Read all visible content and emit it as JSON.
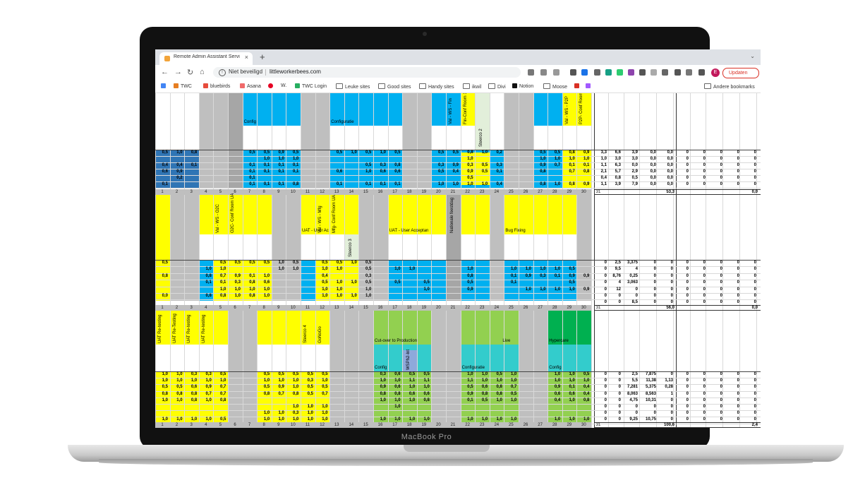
{
  "device": {
    "brand": "MacBook Pro"
  },
  "browser": {
    "tab_title": "Remote Admin Assistant Servi",
    "security_label": "Niet beveiligd",
    "url": "littleworkerbees.com",
    "update_label": "Updaten",
    "profile_initial": "E",
    "bookmarks": [
      "TWC",
      "bluebirds",
      "Asana",
      "W.",
      "TWC Login",
      "Leuke sites",
      "Good sites",
      "Handy sites",
      "ikwil",
      "Divi",
      "Notion",
      "Moose"
    ],
    "other_bookmarks": "Andere bookmarks"
  },
  "colors": {
    "blue": "#00b0f0",
    "yellow": "#ffff00",
    "gray": "#bfbfbf",
    "green": "#92d050",
    "cyan": "#33cccc",
    "darkblue": "#2f75b5",
    "darkgreen": "#00b050"
  },
  "sheet": {
    "bands": [
      {
        "labels": [
          "Config",
          "Configuratie"
        ],
        "vertical_labels": [
          "Val - WS - Fin",
          "Fin-Conf Room 1",
          "Steerco 2",
          "Val - WS - P2P",
          "P2P- Conf Room"
        ],
        "summary_rows": [
          [
            "3,3",
            "6,6",
            "3,9",
            "0,0",
            "0,0"
          ],
          [
            "1,0",
            "3,0",
            "3,0",
            "0,0",
            "0,0"
          ],
          [
            "1,1",
            "6,3",
            "0,0",
            "0,0",
            "0,0"
          ],
          [
            "2,1",
            "5,7",
            "2,9",
            "0,0",
            "0,0"
          ],
          [
            "0,4",
            "0,8",
            "0,5",
            "0,0",
            "0,0"
          ],
          [
            "1,1",
            "3,9",
            "7,9",
            "0,0",
            "0,0"
          ]
        ],
        "total": "53,3",
        "right_total": "0,0"
      },
      {
        "labels": [
          "UAT - User Ac",
          "UAT - User Acceptan",
          "Bug Fixing"
        ],
        "vertical_labels": [
          "Val - WS - O2C",
          "O2C- Conf Room UA",
          "Val - WS - Mfg",
          "Mfg- Conf Room UA",
          "Steerco 3",
          "Nationale feestdag"
        ],
        "summary_rows": [
          [
            "0",
            "2,5",
            "3,375",
            "0",
            "0"
          ],
          [
            "0",
            "9,5",
            "4",
            "0",
            "0"
          ],
          [
            "0",
            "8,76",
            "0,25",
            "0",
            "0"
          ],
          [
            "0",
            "4",
            "3,063",
            "0",
            "0"
          ],
          [
            "0",
            "12",
            "0",
            "0",
            "0"
          ],
          [
            "0",
            "0",
            "0",
            "0",
            "0"
          ],
          [
            "0",
            "0",
            "8,5",
            "0",
            "0"
          ]
        ],
        "total": "56,0",
        "right_total": "0,0"
      },
      {
        "labels": [
          "Cut-over to Production",
          "Live",
          "Hypercare",
          "Config",
          "Configuratie",
          "Config"
        ],
        "vertical_labels": [
          "UAT Re-testing",
          "UAT Re-Testing",
          "UAT Re-testing",
          "UAT Re-testing",
          "Steerco 4",
          "GoNoGo",
          "WSPh2-Int"
        ],
        "summary_rows": [
          [
            "0",
            "0",
            "2,5",
            "7,875",
            "0"
          ],
          [
            "0",
            "0",
            "5,5",
            "11,38",
            "1,13"
          ],
          [
            "0",
            "0",
            "7,281",
            "5,375",
            "0,28"
          ],
          [
            "0",
            "0",
            "8,063",
            "8,563",
            "1"
          ],
          [
            "0",
            "0",
            "4,75",
            "10,31",
            "0"
          ],
          [
            "0",
            "0",
            "0",
            "0",
            "0"
          ],
          [
            "0",
            "0",
            "0",
            "0",
            "0"
          ],
          [
            "0",
            "0",
            "9,25",
            "10,75",
            "0"
          ]
        ],
        "total": "100,6",
        "right_total": "2,4"
      }
    ],
    "band1_values": [
      [
        "0,5",
        "1,0",
        "0,8",
        "",
        "",
        "",
        "0,5",
        "0,5",
        "0,9",
        "0,5",
        "",
        "",
        "0,5",
        "1,0",
        "0,5",
        "1,0",
        "0,5",
        "",
        "",
        "0,5",
        "0,5",
        "0,8",
        "1,0",
        "0,2",
        "",
        "",
        "0,5",
        "0,5",
        "0,8",
        "0,9"
      ],
      [
        "",
        "",
        "",
        "",
        "",
        "",
        "",
        "1,0",
        "1,0",
        "1,0",
        "",
        "",
        "",
        "",
        "",
        "",
        "",
        "",
        "",
        "",
        "",
        "1,0",
        "",
        "",
        "",
        "",
        "1,0",
        "1,0",
        "1,0",
        "1,0"
      ],
      [
        "0,4",
        "0,4",
        "0,1",
        "",
        "",
        "",
        "0,1",
        "0,1",
        "0,1",
        "0,1",
        "",
        "",
        "",
        "",
        "0,5",
        "0,3",
        "0,8",
        "",
        "",
        "0,3",
        "0,9",
        "0,3",
        "0,5",
        "0,3",
        "",
        "",
        "0,9",
        "0,7",
        "0,1",
        "0,1"
      ],
      [
        "0,6",
        "0,9",
        "",
        "",
        "",
        "",
        "0,1",
        "0,1",
        "0,1",
        "0,1",
        "",
        "",
        "0,6",
        "",
        "1,0",
        "0,6",
        "0,6",
        "",
        "",
        "0,5",
        "0,4",
        "0,9",
        "0,5",
        "0,1",
        "",
        "",
        "0,8",
        "",
        "0,7",
        "0,8"
      ],
      [
        "",
        "0,2",
        "",
        "",
        "",
        "",
        "0,1",
        "",
        "",
        "",
        "",
        "",
        "",
        "",
        "",
        "",
        "",
        "",
        "",
        "",
        "",
        "0,5",
        "",
        "",
        "",
        "",
        "",
        "",
        "",
        ""
      ],
      [
        "0,1",
        "",
        "",
        "",
        "",
        "",
        "0,1",
        "0,1",
        "0,1",
        "0,8",
        "",
        "",
        "0,1",
        "",
        "0,1",
        "0,1",
        "0,1",
        "",
        "",
        "1,0",
        "1,0",
        "1,0",
        "1,0",
        "0,4",
        "",
        "",
        "0,8",
        "1,0",
        "0,8",
        "0,9"
      ]
    ],
    "band2_values": [
      [
        "0,5",
        "",
        "",
        "",
        "0,5",
        "0,5",
        "0,5",
        "0,5",
        "1,0",
        "0,5",
        "",
        "0,5",
        "0,5",
        "1,0",
        "0,5",
        "",
        "",
        "",
        "",
        "",
        "",
        "",
        "",
        "",
        "",
        "",
        "",
        "",
        "",
        ""
      ],
      [
        "",
        "",
        "",
        "1,0",
        "1,0",
        "",
        "",
        "",
        "1,0",
        "1,0",
        "",
        "1,0",
        "1,0",
        "",
        "0,5",
        "",
        "1,0",
        "1,0",
        "",
        "",
        "",
        "1,0",
        "",
        "",
        "1,0",
        "1,0",
        "1,0",
        "1,0",
        "0,5",
        ""
      ],
      [
        "0,8",
        "",
        "",
        "0,8",
        "0,7",
        "0,9",
        "0,1",
        "1,0",
        "",
        "",
        "",
        "0,4",
        "",
        "",
        "0,3",
        "",
        "",
        "",
        "",
        "",
        "",
        "0,8",
        "",
        "",
        "0,1",
        "0,9",
        "0,3",
        "0,1",
        "0,9",
        "0,9"
      ],
      [
        "",
        "",
        "",
        "0,1",
        "0,1",
        "0,3",
        "0,8",
        "0,6",
        "",
        "",
        "",
        "0,5",
        "1,0",
        "1,0",
        "0,5",
        "",
        "0,5",
        "",
        "0,5",
        "",
        "",
        "0,5",
        "",
        "",
        "0,1",
        "",
        "",
        "",
        "0,5",
        ""
      ],
      [
        "",
        "",
        "",
        "",
        "1,0",
        "1,0",
        "1,0",
        "1,0",
        "",
        "",
        "",
        "1,0",
        "1,0",
        "",
        "1,0",
        "",
        "",
        "",
        "1,0",
        "",
        "",
        "0,9",
        "",
        "",
        "",
        "1,0",
        "1,0",
        "1,0",
        "1,0",
        "0,9"
      ],
      [
        "0,0",
        "",
        "",
        "0,8",
        "0,8",
        "1,0",
        "0,8",
        "1,0",
        "",
        "",
        "",
        "1,0",
        "1,0",
        "1,0",
        "1,0",
        "",
        "",
        "",
        "",
        "",
        "",
        "",
        "",
        "",
        "",
        "",
        "",
        "",
        "",
        ""
      ]
    ],
    "band3_values": [
      [
        "1,0",
        "1,0",
        "0,3",
        "0,3",
        "0,5",
        "",
        "",
        "0,5",
        "0,5",
        "0,5",
        "0,5",
        "0,5",
        "",
        "",
        "",
        "0,3",
        "0,6",
        "0,5",
        "0,5",
        "",
        "",
        "1,0",
        "1,0",
        "0,5",
        "1,0",
        "",
        "",
        "1,0",
        "1,0",
        "0,5"
      ],
      [
        "1,0",
        "1,0",
        "1,0",
        "1,0",
        "1,0",
        "",
        "",
        "1,0",
        "1,0",
        "1,0",
        "0,3",
        "1,0",
        "",
        "",
        "",
        "1,0",
        "1,0",
        "1,1",
        "1,1",
        "",
        "",
        "1,1",
        "1,0",
        "1,0",
        "1,0",
        "",
        "",
        "1,0",
        "1,0",
        "1,0"
      ],
      [
        "0,5",
        "0,5",
        "0,6",
        "0,9",
        "0,7",
        "",
        "",
        "0,5",
        "0,9",
        "1,0",
        "0,5",
        "0,5",
        "",
        "",
        "",
        "0,9",
        "0,6",
        "1,0",
        "1,0",
        "",
        "",
        "0,5",
        "0,6",
        "0,8",
        "0,7",
        "",
        "",
        "0,9",
        "0,1",
        "0,4"
      ],
      [
        "0,8",
        "0,8",
        "0,8",
        "0,7",
        "0,7",
        "",
        "",
        "0,8",
        "0,7",
        "0,8",
        "0,5",
        "0,7",
        "",
        "",
        "",
        "0,8",
        "0,8",
        "0,6",
        "0,6",
        "",
        "",
        "0,9",
        "0,8",
        "0,8",
        "0,5",
        "",
        "",
        "0,6",
        "0,6",
        "0,4"
      ],
      [
        "1,0",
        "1,0",
        "0,8",
        "1,0",
        "0,8",
        "",
        "",
        "",
        "",
        "",
        "",
        "",
        "",
        "",
        "",
        "1,0",
        "1,0",
        "1,0",
        "0,8",
        "",
        "",
        "0,1",
        "0,5",
        "1,0",
        "1,0",
        "",
        "",
        "0,4",
        "1,0",
        "0,8"
      ],
      [
        "",
        "",
        "",
        "",
        "",
        "",
        "",
        "",
        "",
        "1,0",
        "1,0",
        "1,0",
        "",
        "",
        "",
        "",
        "1,0",
        "",
        "",
        "",
        "",
        "",
        "",
        "",
        "",
        "",
        "",
        "",
        "",
        ""
      ],
      [
        "",
        "",
        "",
        "",
        "",
        "",
        "",
        "1,0",
        "1,0",
        "0,3",
        "1,0",
        "1,0",
        "",
        "",
        "",
        "",
        "",
        "",
        "",
        "",
        "",
        "",
        "",
        "",
        "",
        "",
        "",
        "",
        "",
        ""
      ],
      [
        "1,0",
        "1,0",
        "1,0",
        "1,0",
        "0,5",
        "",
        "",
        "1,0",
        "1,0",
        "1,0",
        "1,0",
        "1,0",
        "",
        "",
        "",
        "1,0",
        "1,0",
        "1,0",
        "1,0",
        "",
        "",
        "1,0",
        "1,0",
        "1,0",
        "1,0",
        "",
        "",
        "1,0",
        "1,0",
        "1,0"
      ]
    ],
    "day_numbers": [
      "1",
      "2",
      "3",
      "4",
      "5",
      "6",
      "7",
      "8",
      "9",
      "10",
      "11",
      "12",
      "13",
      "14",
      "15",
      "16",
      "17",
      "18",
      "19",
      "20",
      "21",
      "22",
      "23",
      "24",
      "25",
      "26",
      "27",
      "28",
      "29",
      "30",
      "31"
    ]
  }
}
